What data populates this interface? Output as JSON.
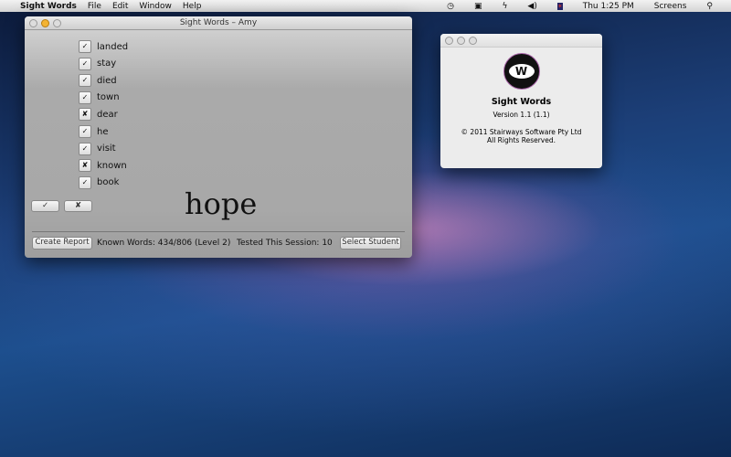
{
  "menubar": {
    "apple": "",
    "app": "Sight Words",
    "items": [
      "File",
      "Edit",
      "Window",
      "Help"
    ],
    "clock": "Thu 1:25 PM",
    "user": "Screens",
    "search": "⚲"
  },
  "main_window": {
    "title": "Sight Words – Amy",
    "words": [
      {
        "word": "landed",
        "known": true,
        "mark": "✓"
      },
      {
        "word": "stay",
        "known": true,
        "mark": "✓"
      },
      {
        "word": "died",
        "known": true,
        "mark": "✓"
      },
      {
        "word": "town",
        "known": true,
        "mark": "✓"
      },
      {
        "word": "dear",
        "known": false,
        "mark": "✘"
      },
      {
        "word": "he",
        "known": true,
        "mark": "✓"
      },
      {
        "word": "visit",
        "known": true,
        "mark": "✓"
      },
      {
        "word": "known",
        "known": false,
        "mark": "✘"
      },
      {
        "word": "book",
        "known": true,
        "mark": "✓"
      }
    ],
    "correct_button": "✓",
    "wrong_button": "✘",
    "current_word": "hope",
    "create_report": "Create Report",
    "known_words": "Known Words:  434/806 (Level 2)",
    "tested": "Tested This Session:  10",
    "select_student": "Select Student"
  },
  "about_window": {
    "logo": "W",
    "app_name": "Sight Words",
    "version": "Version 1.1 (1.1)",
    "copyright": "© 2011 Stairways Software Pty Ltd",
    "rights": "All Rights Reserved."
  }
}
